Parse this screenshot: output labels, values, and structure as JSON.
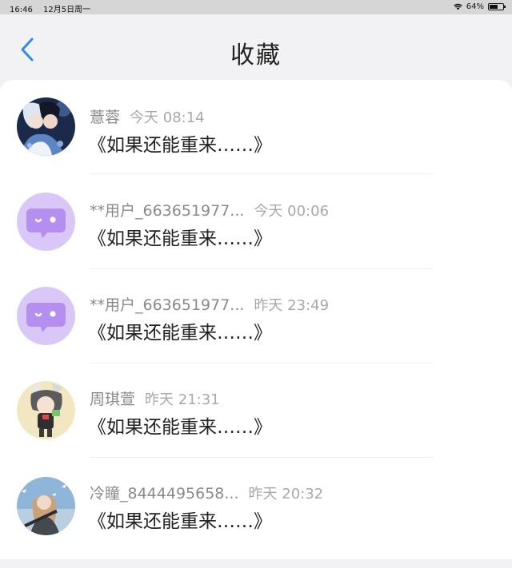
{
  "status_bar": {
    "time": "16:46",
    "date": "12月5日周一",
    "battery": "64%",
    "battery_level": 0.64
  },
  "header": {
    "title": "收藏",
    "back_icon": "chevron-left-icon"
  },
  "colors": {
    "accent": "#2f8de4",
    "bot_avatar_bg": "#d9c7f7",
    "bot_avatar_bubble": "#b58ff0"
  },
  "favorites": [
    {
      "author": "薏蓉",
      "time": "今天 08:14",
      "title": "《如果还能重来……》",
      "avatar": "anime-boys-avatar"
    },
    {
      "author": "**用户_663651977...",
      "time": "今天 00:06",
      "title": "《如果还能重来……》",
      "avatar": "chat-bubble-avatar"
    },
    {
      "author": "**用户_663651977...",
      "time": "昨天 23:49",
      "title": "《如果还能重来……》",
      "avatar": "chat-bubble-avatar"
    },
    {
      "author": "周琪萱",
      "time": "昨天 21:31",
      "title": "《如果还能重来……》",
      "avatar": "chibi-girl-avatar"
    },
    {
      "author": "冷瞳_8444495658...",
      "time": "昨天 20:32",
      "title": "《如果还能重来……》",
      "avatar": "soldier-girl-avatar"
    }
  ]
}
